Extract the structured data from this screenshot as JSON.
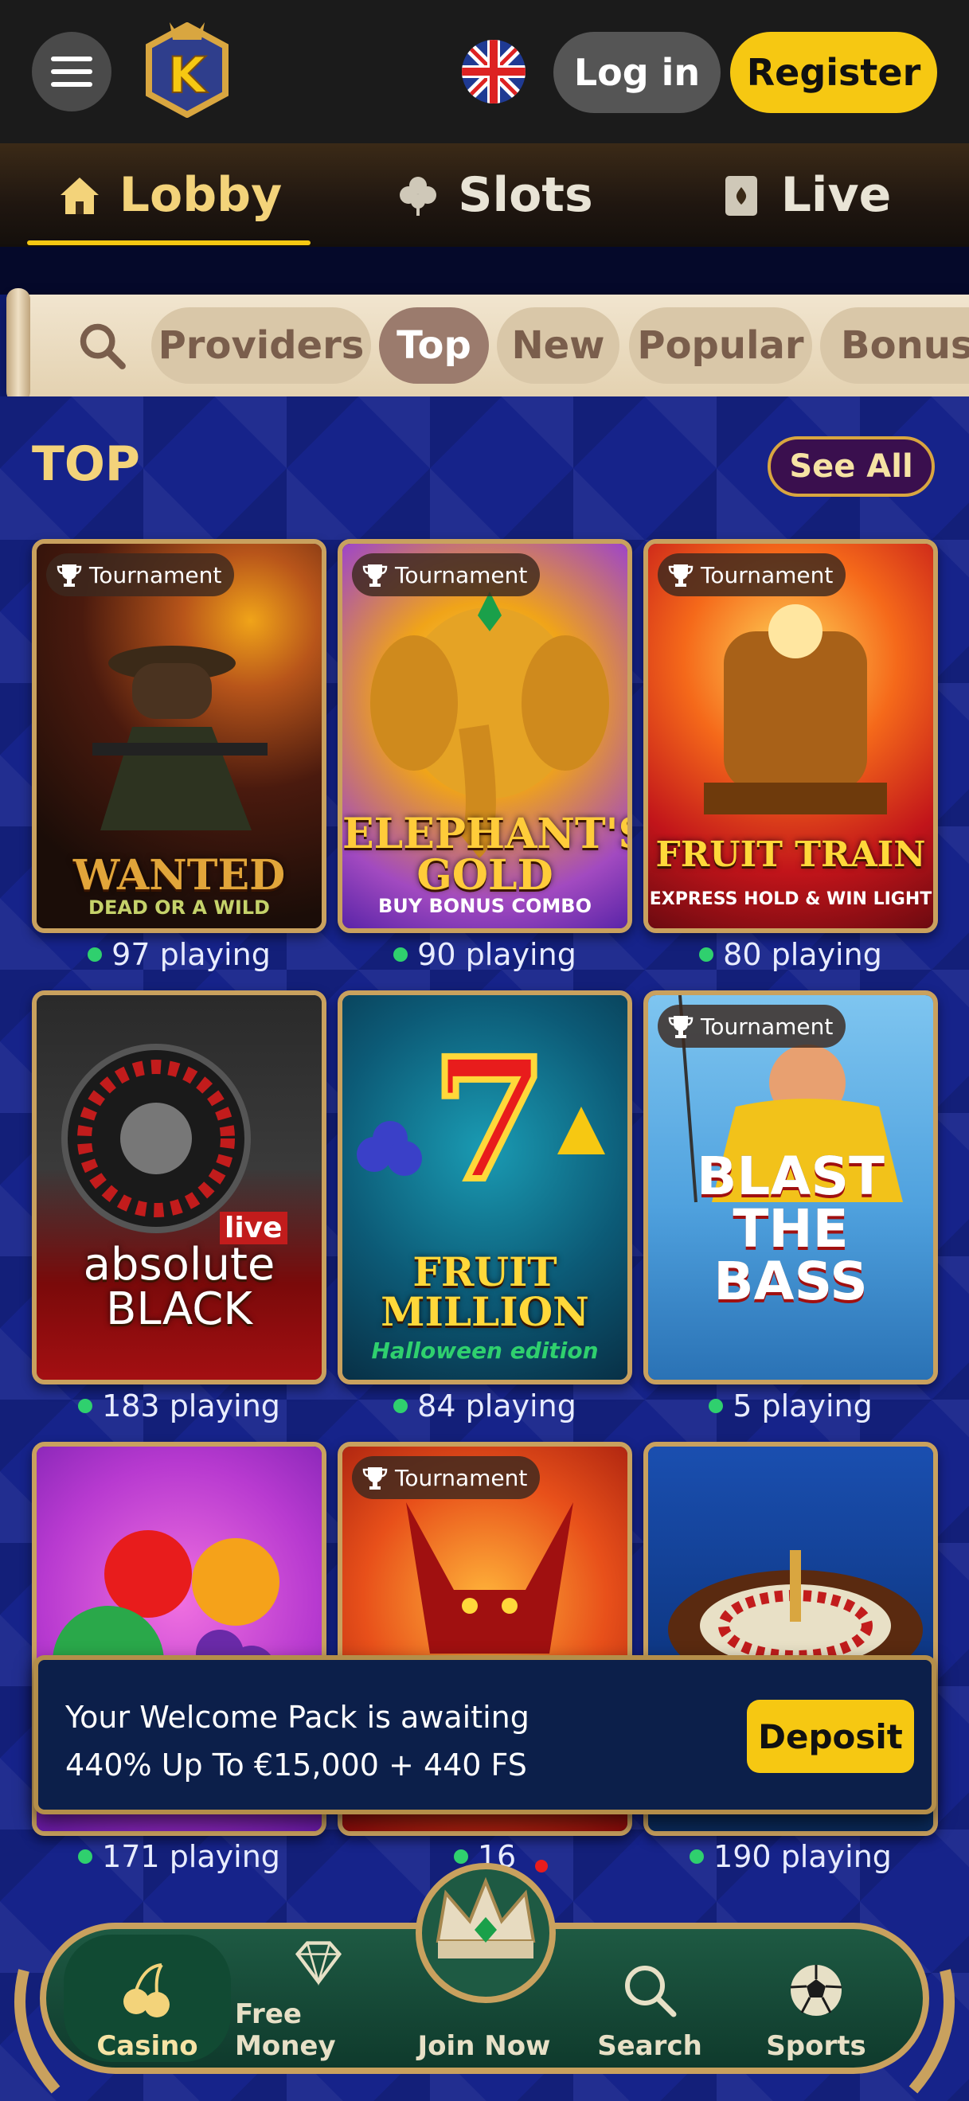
{
  "header": {
    "menu_icon": "hamburger-menu-icon",
    "logo_letter": "K",
    "language_flag": "uk-flag-icon",
    "login_label": "Log in",
    "register_label": "Register"
  },
  "tabs": [
    {
      "label": "Lobby",
      "icon": "house-icon",
      "active": true
    },
    {
      "label": "Slots",
      "icon": "clover-icon",
      "active": false
    },
    {
      "label": "Live",
      "icon": "playing-card-icon",
      "active": false
    }
  ],
  "filters": {
    "search_icon": "search-icon",
    "chips": [
      "Providers",
      "Top",
      "New",
      "Popular",
      "Bonus"
    ],
    "active": "Top"
  },
  "section": {
    "title": "TOP",
    "see_all": "See All"
  },
  "badge_label": "Tournament",
  "games": [
    {
      "title": "WANTED",
      "subtitle": "DEAD OR A WILD",
      "tournament": true,
      "playing": "97 playing"
    },
    {
      "title": "ELEPHANT'S GOLD",
      "subtitle": "BUY BONUS COMBO",
      "tournament": true,
      "playing": "90 playing"
    },
    {
      "title": "FRUIT TRAIN",
      "subtitle": "EXPRESS HOLD & WIN LIGHT",
      "tournament": true,
      "playing": "80 playing"
    },
    {
      "title": "absolute BLACK",
      "subtitle": "live",
      "tournament": false,
      "playing": "183 playing"
    },
    {
      "title": "FRUIT MILLION",
      "subtitle": "Halloween edition",
      "tournament": false,
      "playing": "84 playing"
    },
    {
      "title": "BLAST THE BASS",
      "subtitle": "",
      "tournament": true,
      "playing": "5 playing"
    },
    {
      "title": "",
      "subtitle": "",
      "tournament": false,
      "playing": "171 playing"
    },
    {
      "title": "",
      "subtitle": "",
      "tournament": true,
      "playing": "16"
    },
    {
      "title": "",
      "subtitle": "",
      "tournament": false,
      "playing": "190 playing"
    }
  ],
  "welcome": {
    "line1": "Your Welcome Pack is awaiting",
    "line2": "440% Up To €15,000 + 440 FS",
    "deposit_label": "Deposit"
  },
  "bottom_nav": [
    {
      "label": "Casino",
      "icon": "cherry-icon",
      "active": true
    },
    {
      "label": "Free Money",
      "icon": "diamond-icon",
      "active": false
    },
    {
      "label": "Join Now",
      "icon": "crown-icon",
      "active": false
    },
    {
      "label": "Search",
      "icon": "search-icon",
      "active": false
    },
    {
      "label": "Sports",
      "icon": "soccer-ball-icon",
      "active": false
    }
  ],
  "colors": {
    "accent_yellow": "#f6c812",
    "gold": "#c9a15e",
    "background_blue": "#16238a",
    "nav_green": "#1e5a43"
  }
}
